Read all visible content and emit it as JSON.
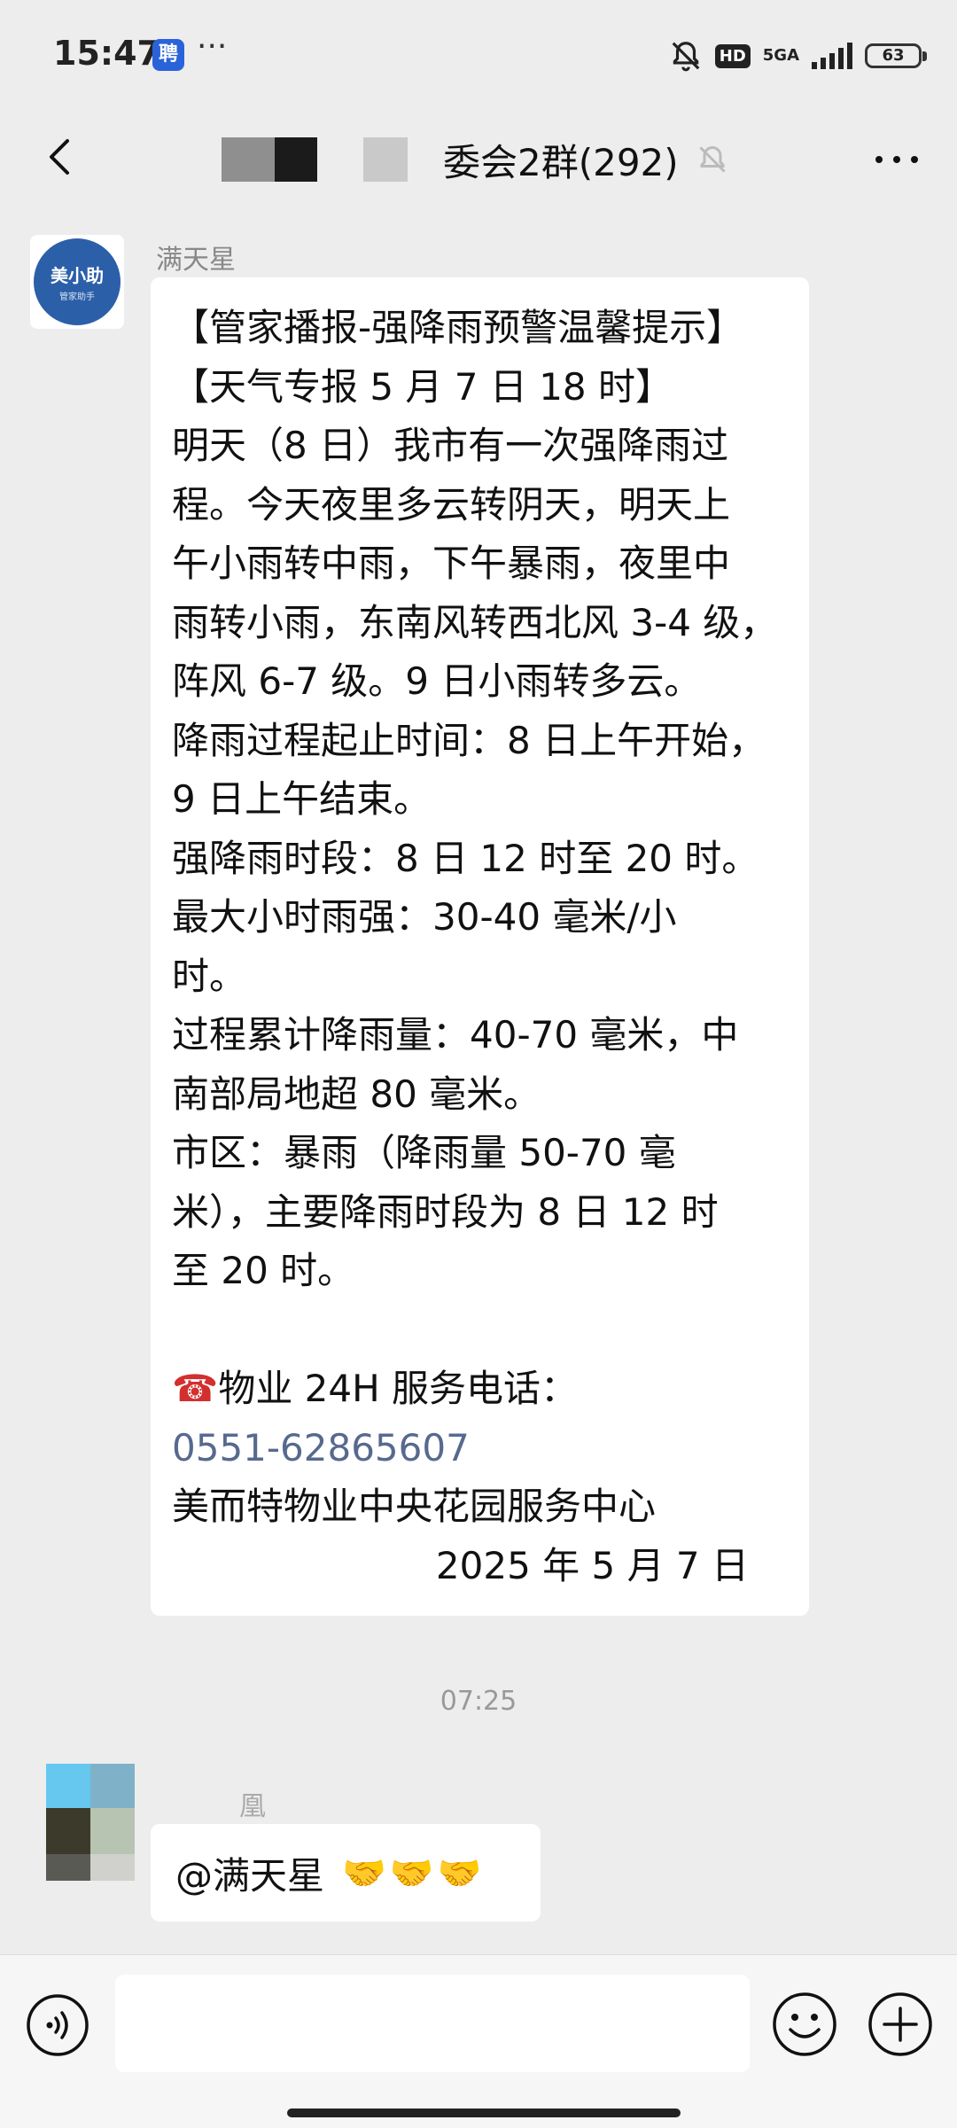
{
  "status_bar": {
    "time": "15:47",
    "app_badge": "聘",
    "more": "···",
    "hd": "HD",
    "network": "5GA",
    "battery": "63"
  },
  "nav": {
    "title": "委会2群(292)",
    "icons": [
      "back-icon",
      "mute-bell-icon",
      "more-icon"
    ]
  },
  "messages": [
    {
      "sender": "满天星",
      "avatar_text": "美小助",
      "avatar_sub": "管家助手",
      "lines": [
        "【管家播报-强降雨预警温馨提示】",
        "【天气专报 5 月 7 日 18 时】",
        "明天（8 日）我市有一次强降雨过",
        "程。今天夜里多云转阴天，明天上",
        "午小雨转中雨，下午暴雨，夜里中",
        "雨转小雨，东南风转西北风 3-4 级，",
        "阵风 6-7 级。9 日小雨转多云。",
        "降雨过程起止时间：8 日上午开始，",
        "9 日上午结束。",
        "强降雨时段：8 日 12 时至 20 时。",
        "最大小时雨强：30-40 毫米/小",
        "时。",
        "过程累计降雨量：40-70 毫米，中",
        "南部局地超 80 毫米。",
        "市区：暴雨（降雨量 50-70 毫",
        "米），主要降雨时段为 8 日 12 时",
        "至 20 时。"
      ],
      "service_line": "物业 24H 服务电话：",
      "phone_emoji": "☎",
      "phone": "0551-62865607",
      "org": "美而特物业中央花园服务中心",
      "date": "2025 年 5 月 7 日"
    }
  ],
  "time_separator": "07:25",
  "reply": {
    "sender": "凰",
    "text": "@满天星",
    "emojis": "🤝🤝🤝"
  },
  "input": {
    "placeholder": "",
    "icons": [
      "voice-icon",
      "emoji-icon",
      "plus-icon"
    ]
  }
}
